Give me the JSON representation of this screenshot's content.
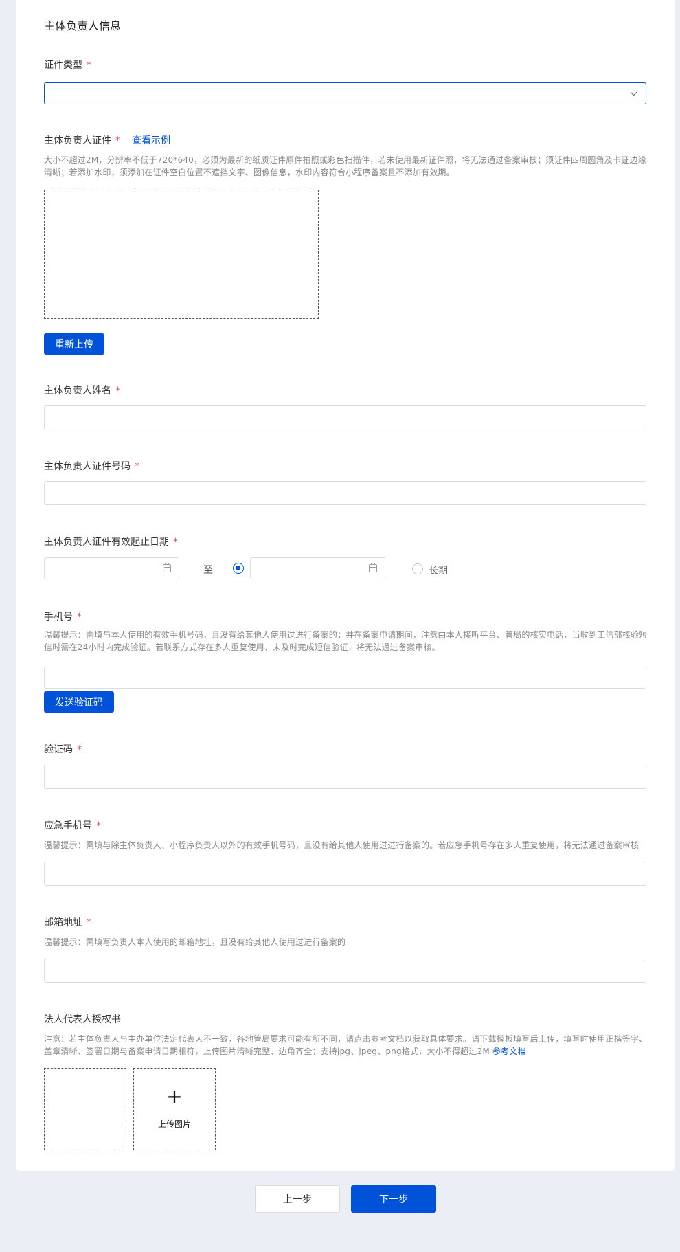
{
  "section_title": "主体负责人信息",
  "required_mark": "*",
  "cert_type": {
    "label": "证件类型",
    "value": ""
  },
  "cert_upload": {
    "label": "主体负责人证件",
    "example_link": "查看示例",
    "hint": "大小不超过2M，分辨率不低于720*640，必须为最新的纸质证件原件拍照或彩色扫描件，若未使用最新证件照，将无法通过备案审核；须证件四周圆角及卡证边缘清晰；若添加水印，须添加在证件空白位置不遮挡文字、图像信息，水印内容符合小程序备案且不添加有效期。",
    "reupload_button": "重新上传"
  },
  "name": {
    "label": "主体负责人姓名",
    "value": ""
  },
  "cert_number": {
    "label": "主体负责人证件号码",
    "value": ""
  },
  "validity": {
    "label": "主体负责人证件有效起止日期",
    "start_value": "",
    "to_text": "至",
    "end_value": "",
    "long_term_label": "长期"
  },
  "phone": {
    "label": "手机号",
    "hint": "温馨提示：需填与本人使用的有效手机号码，且没有给其他人使用过进行备案的；并在备案申请期间，注意由本人接听平台、管局的核实电话，当收到工信部核验短信时需在24小时内完成验证。若联系方式存在多人重复使用、未及时完成短信验证，将无法通过备案审核。",
    "value": "",
    "send_code_button": "发送验证码"
  },
  "verify_code": {
    "label": "验证码",
    "value": ""
  },
  "emergency_phone": {
    "label": "应急手机号",
    "hint": "温馨提示：需填与除主体负责人、小程序负责人以外的有效手机号码，且没有给其他人使用过进行备案的。若应急手机号存在多人重复使用，将无法通过备案审核",
    "value": ""
  },
  "email": {
    "label": "邮箱地址",
    "hint": "温馨提示：需填写负责人本人使用的邮箱地址，且没有给其他人使用过进行备案的",
    "value": ""
  },
  "authorization": {
    "label": "法人代表人授权书",
    "hint": "注意：若主体负责人与主办单位法定代表人不一致，各地管局要求可能有所不同，请点击参考文档以获取具体要求。请下载模板填写后上传，填写时使用正楷签字、盖章清晰、签署日期与备案申请日期相符，上传图片清晰完整、边角齐全；支持jpg、jpeg、png格式，大小不得超过2M",
    "doc_link": "参考文档",
    "upload_plus": "+",
    "upload_label": "上传图片"
  },
  "footer": {
    "prev_button": "上一步",
    "next_button": "下一步"
  },
  "colors": {
    "primary": "#0052d9",
    "required": "#e34d59",
    "background": "#ebeef5"
  }
}
